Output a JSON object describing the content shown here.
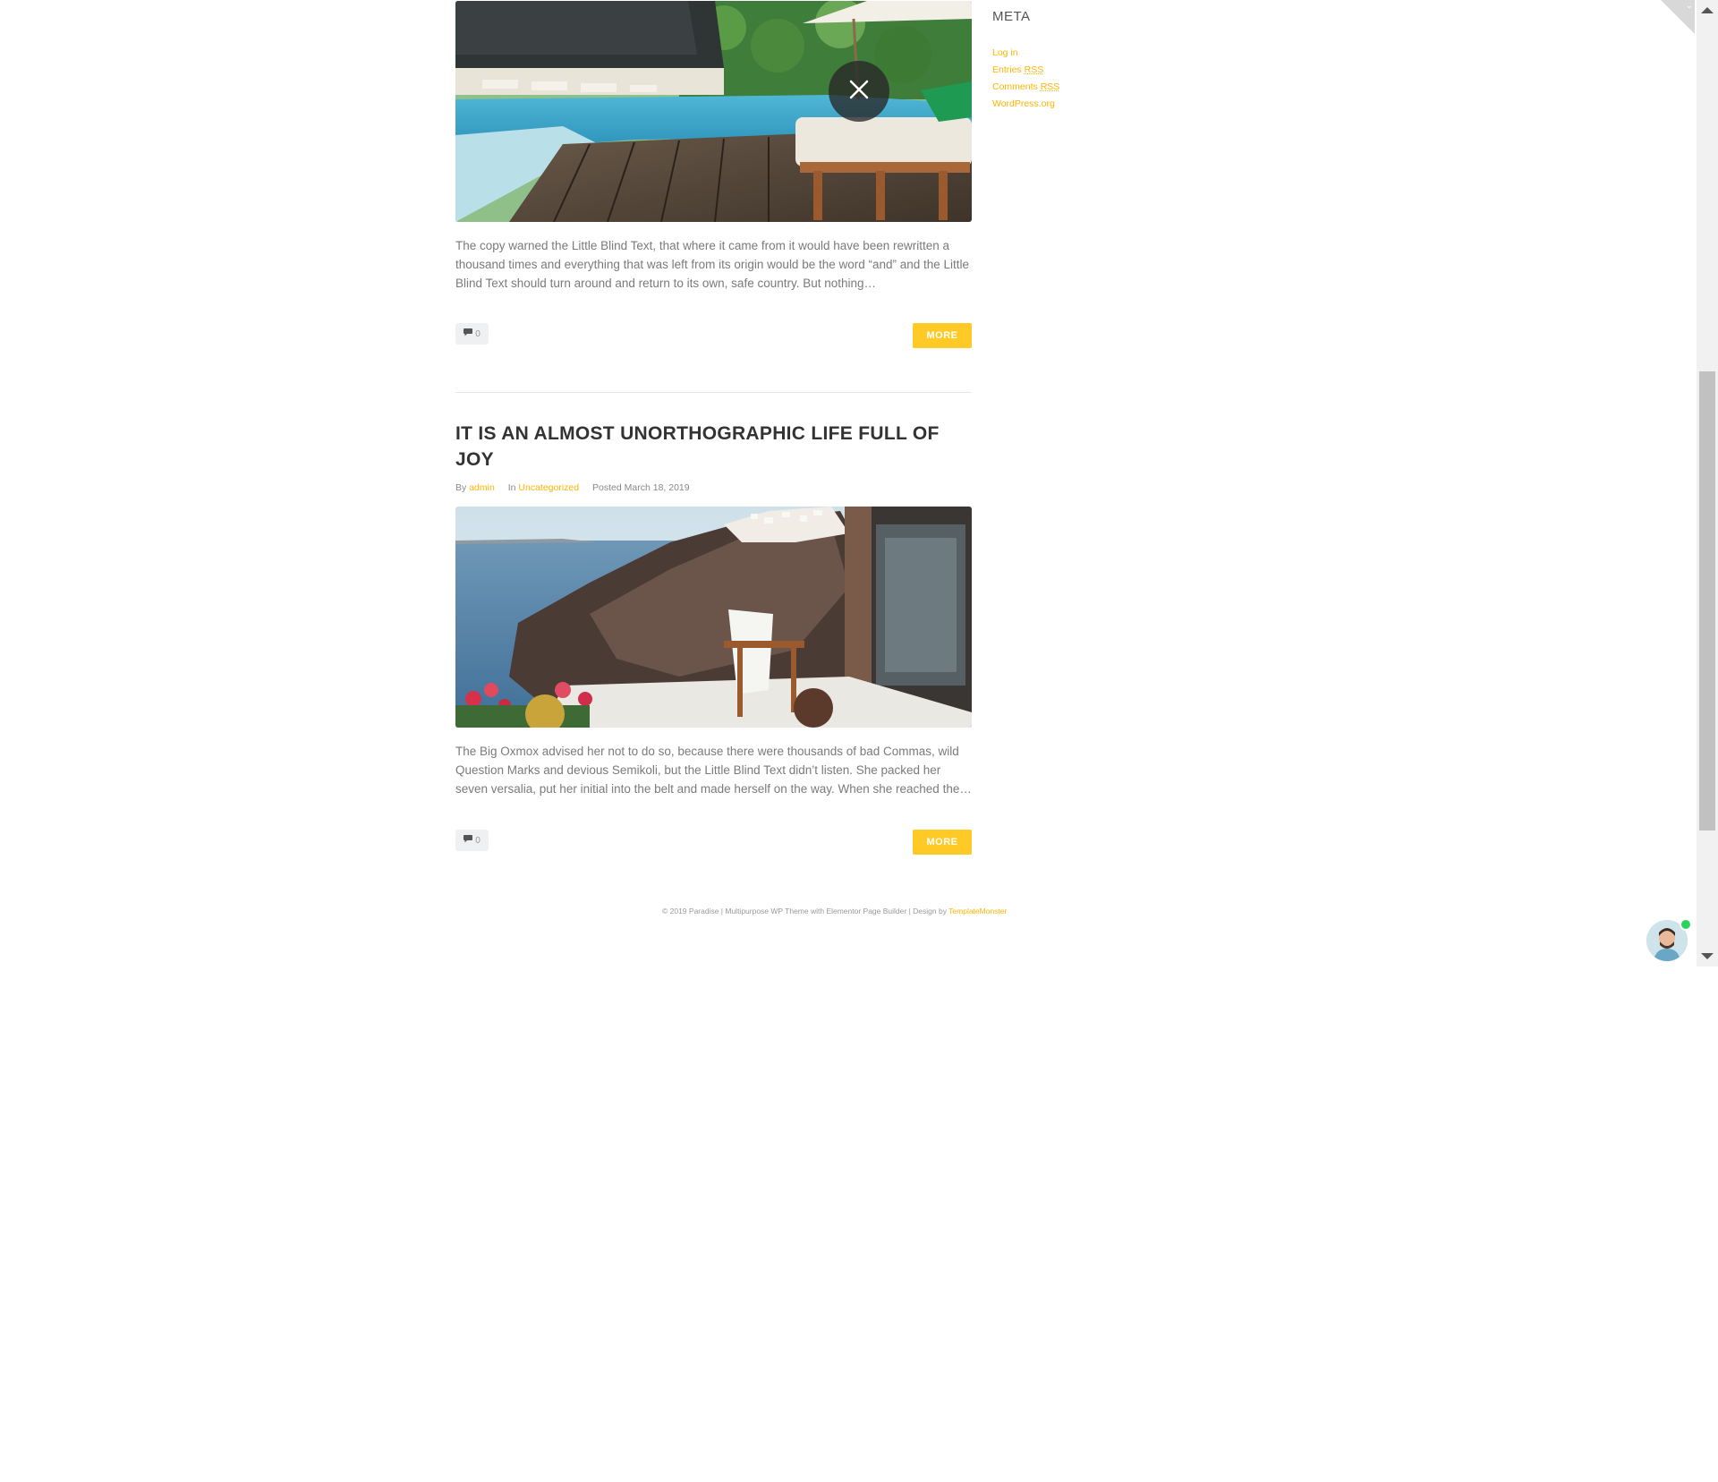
{
  "posts": [
    {
      "excerpt": "The copy warned the Little Blind Text, that where it came from it would have been rewritten a thousand times and everything that was left from its origin would be the word “and” and the Little Blind Text should turn around and return to its own, safe country. But nothing…",
      "comments": "0",
      "more_label": "MORE"
    },
    {
      "title": "IT IS AN ALMOST UNORTHOGRAPHIC LIFE FULL OF JOY",
      "by_label": "By",
      "author": "admin",
      "in_label": "In",
      "category": "Uncategorized",
      "posted": "Posted March 18, 2019",
      "excerpt": "The Big Oxmox advised her not to do so, because there were thousands of bad Commas, wild Question Marks and devious Semikoli, but the Little Blind Text didn’t listen. She packed her seven versalia, put her initial into the belt and made herself on the way. When she reached the…",
      "comments": "0",
      "more_label": "MORE"
    }
  ],
  "sidebar": {
    "meta_title": "META",
    "links": [
      {
        "label": "Log in"
      },
      {
        "label": "Entries ",
        "abbr": "RSS"
      },
      {
        "label": "Comments ",
        "abbr": "RSS"
      },
      {
        "label": "WordPress.org"
      }
    ]
  },
  "footer": {
    "text": "© 2019 Paradise | Multipurpose WP Theme with Elementor Page Builder | Design by ",
    "link": "TemplateMonster"
  },
  "colors": {
    "accent": "#ffc926",
    "link": "#ffb400",
    "online": "#2bd35a"
  },
  "icons": [
    "comment-icon",
    "close-icon",
    "chevron-down-icon",
    "scroll-up-icon",
    "scroll-down-icon"
  ]
}
